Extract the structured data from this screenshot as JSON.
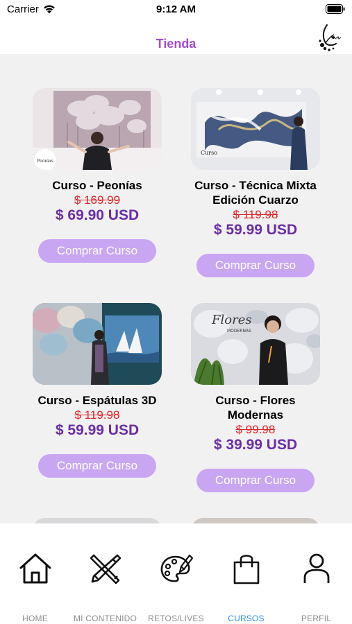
{
  "status_bar": {
    "carrier": "Carrier",
    "time": "9:12 AM"
  },
  "nav": {
    "title": "Tienda"
  },
  "courses": [
    {
      "title": "Curso - Peonías",
      "old_price": "$ 169.99",
      "price": "$ 69.90 USD",
      "button": "Comprar Curso"
    },
    {
      "title": "Curso - Técnica Mixta Edición Cuarzo",
      "old_price": "$ 119.98",
      "price": "$ 59.99 USD",
      "button": "Comprar Curso"
    },
    {
      "title": "Curso - Espátulas 3D",
      "old_price": "$ 119.98",
      "price": "$ 59.99 USD",
      "button": "Comprar Curso"
    },
    {
      "title": "Curso - Flores Modernas",
      "old_price": "$ 99.98",
      "price": "$ 39.99 USD",
      "button": "Comprar Curso"
    }
  ],
  "tabs": [
    {
      "label": "HOME",
      "icon": "home-icon",
      "active": false
    },
    {
      "label": "MI CONTENIDO",
      "icon": "brush-pencil-icon",
      "active": false
    },
    {
      "label": "RETOS/LIVES",
      "icon": "palette-icon",
      "active": false
    },
    {
      "label": "CURSOS",
      "icon": "shopping-bag-icon",
      "active": true
    },
    {
      "label": "PERFIL",
      "icon": "user-icon",
      "active": false
    }
  ],
  "colors": {
    "accent": "#a24bd6",
    "price": "#6a2da8",
    "old_price": "#e0262b",
    "button": "#c9a6f2",
    "active_tab": "#2d8cf0"
  }
}
